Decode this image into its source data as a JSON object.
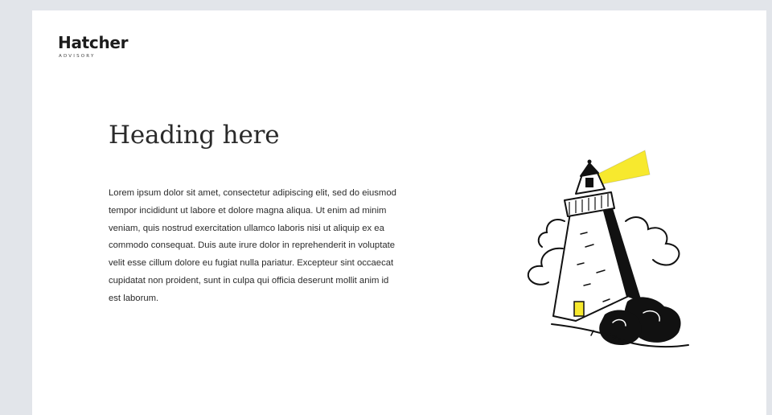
{
  "brand": {
    "name": "Hatcher",
    "tagline": "ADVISORY"
  },
  "content": {
    "heading": "Heading here",
    "body": "Lorem ipsum dolor sit amet, consectetur adipiscing elit, sed do eiusmod tempor incididunt ut labore et dolore magna aliqua. Ut enim ad minim veniam, quis nostrud exercitation ullamco laboris nisi ut aliquip ex ea commodo consequat. Duis aute irure dolor in reprehenderit in voluptate velit esse cillum dolore eu fugiat nulla pariatur. Excepteur sint occaecat cupidatat non proident, sunt in culpa qui officia deserunt mollit anim id est laborum."
  },
  "illustration": {
    "icon": "lighthouse-illustration",
    "accent_color": "#f7e92e",
    "ink_color": "#111111"
  }
}
